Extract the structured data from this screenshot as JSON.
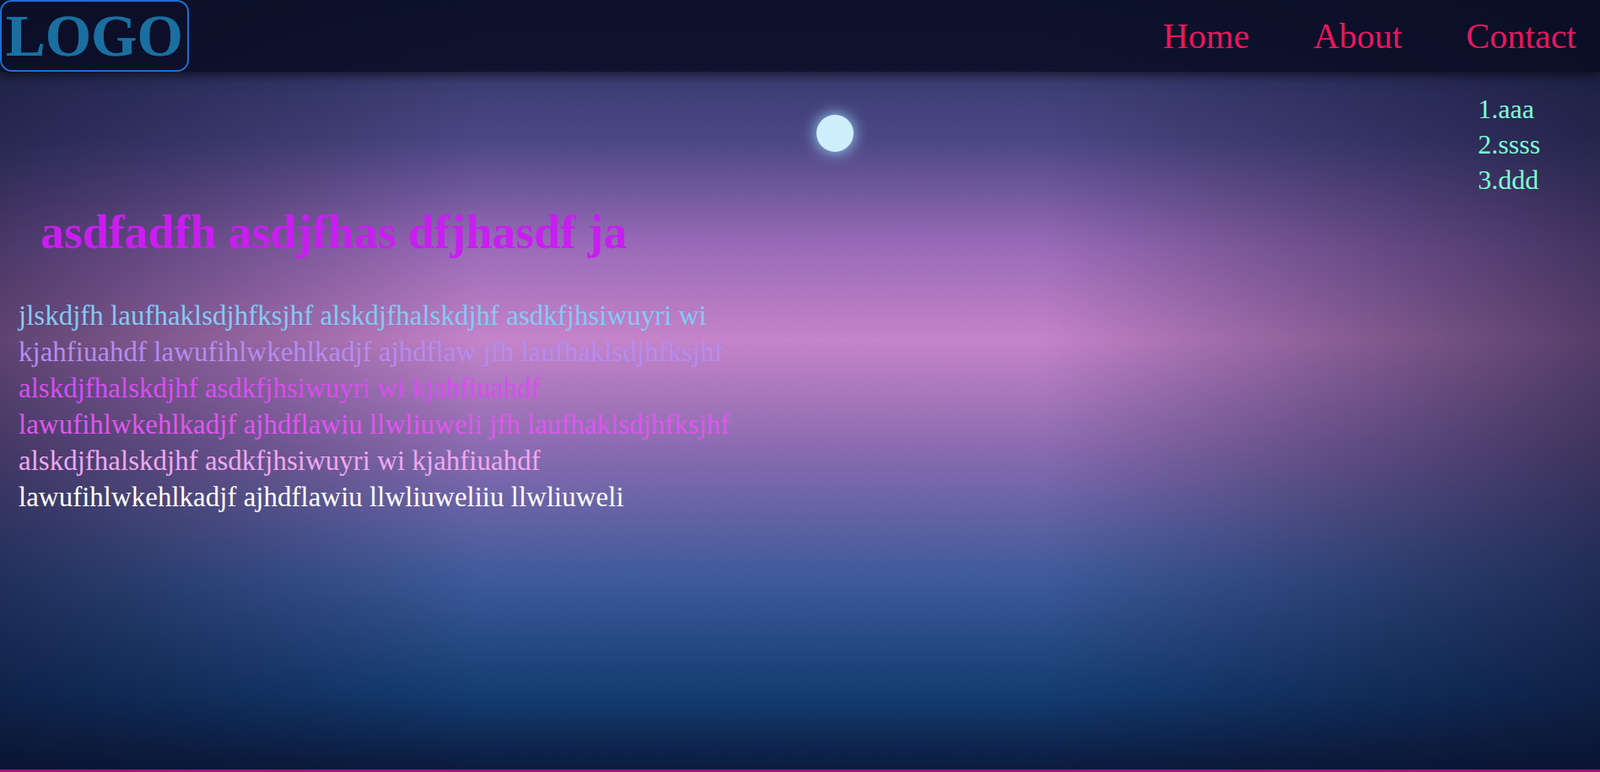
{
  "logo": "LOGO",
  "nav": [
    {
      "label": "Home"
    },
    {
      "label": "About"
    },
    {
      "label": "Contact"
    }
  ],
  "dropdown": [
    "1.aaa",
    "2.ssss",
    "3.ddd"
  ],
  "heading": "asdfadfh asdjfhas dfjhasdf ja",
  "paragraph": [
    "jlskdjfh laufhaklsdjhfksjhf alskdjfhalskdjhf asdkfjhsiwuyri wi",
    "kjahfiuahdf lawufihlwkehlkadjf ajhdflaw jfh laufhaklsdjhfksjhf",
    "alskdjfhalskdjhf asdkfjhsiwuyri wi kjahfiuahdf",
    "lawufihlwkehlkadjf ajhdflawiu llwliuweli jfh laufhaklsdjhfksjhf",
    "alskdjfhalskdjhf asdkfjhsiwuyri wi kjahfiuahdf",
    "lawufihlwkehlkadjf ajhdflawiu llwliuweliiu llwliuweli"
  ]
}
